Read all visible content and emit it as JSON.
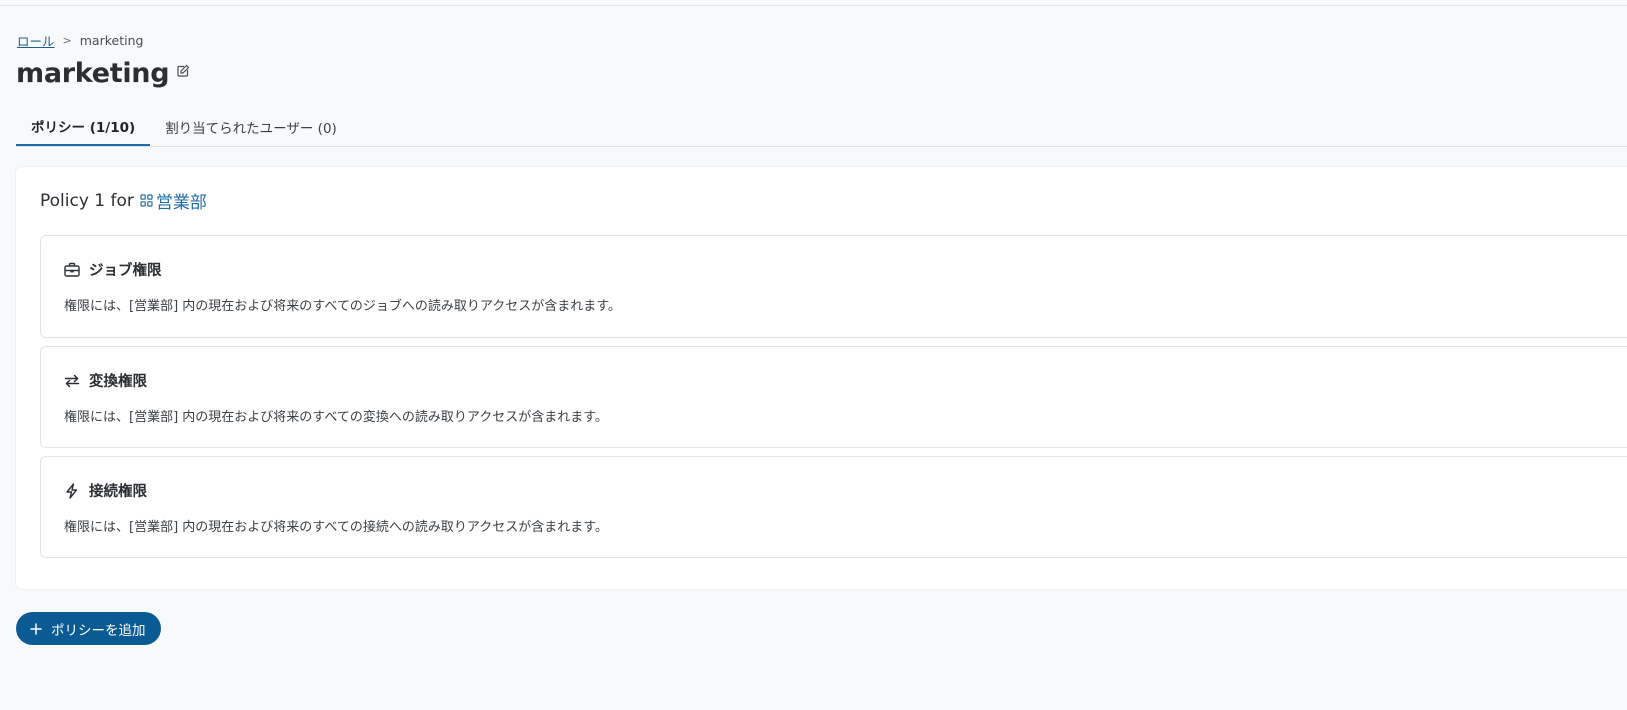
{
  "breadcrumb": {
    "parent": "ロール",
    "separator": ">",
    "current": "marketing"
  },
  "page": {
    "title": "marketing"
  },
  "tabs": [
    {
      "label": "ポリシー (1/10)",
      "active": true
    },
    {
      "label": "割り当てられたユーザー (0)",
      "active": false
    }
  ],
  "policy": {
    "title_prefix": "Policy 1 for",
    "department": "営業部",
    "permissions": [
      {
        "icon": "briefcase-icon",
        "name": "ジョブ権限",
        "description": "権限には、[営業部] 内の現在および将来のすべてのジョブへの読み取りアクセスが含まれます。"
      },
      {
        "icon": "transform-arrows-icon",
        "name": "変換権限",
        "description": "権限には、[営業部] 内の現在および将来のすべての変換への読み取りアクセスが含まれます。"
      },
      {
        "icon": "connection-bolt-icon",
        "name": "接続権限",
        "description": "権限には、[営業部] 内の現在および将来のすべての接続への読み取りアクセスが含まれます。"
      }
    ]
  },
  "actions": {
    "add_policy_label": "ポリシーを追加"
  },
  "colors": {
    "accent": "#1f6da8",
    "button": "#0a5b94",
    "link": "#1f5f8b"
  }
}
